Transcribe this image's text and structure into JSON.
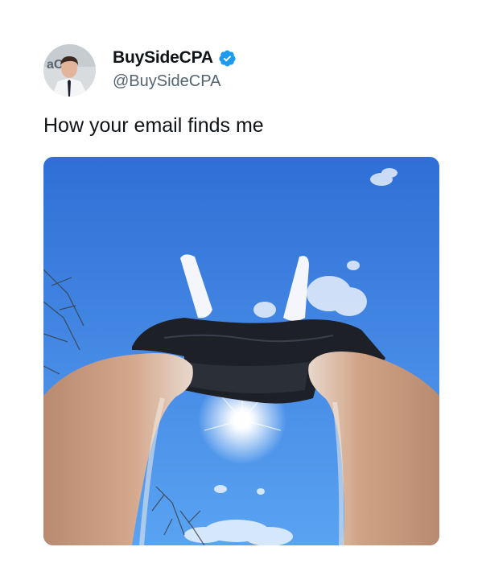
{
  "author": {
    "display_name": "BuySideCPA",
    "handle": "@BuySideCPA",
    "verified": true,
    "verified_color": "#1d9bf0",
    "avatar_icon": "profile-photo"
  },
  "tweet": {
    "text": "How your email finds me",
    "media_icon": "photo-sky-legs-sun"
  },
  "colors": {
    "text": "#0f1419",
    "secondary": "#536471",
    "sky_top": "#2f6fd6",
    "sky_bottom": "#5aa3f2"
  }
}
